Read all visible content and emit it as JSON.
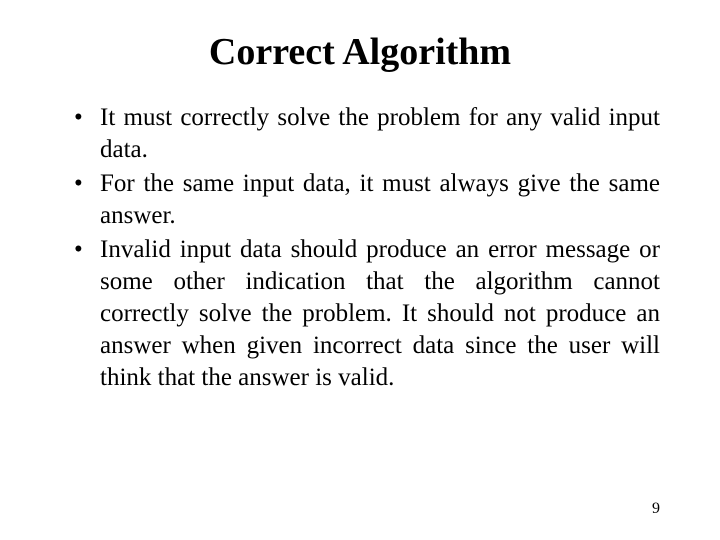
{
  "title": "Correct Algorithm",
  "bullets": [
    "It must correctly solve the problem for any valid input data.",
    "For the same input data, it must always give the same answer.",
    "Invalid input data should produce an error message or some other indication that the algorithm cannot correctly solve the problem. It should not produce an answer when given incorrect data since the user will think that the answer is valid."
  ],
  "pageNumber": "9"
}
